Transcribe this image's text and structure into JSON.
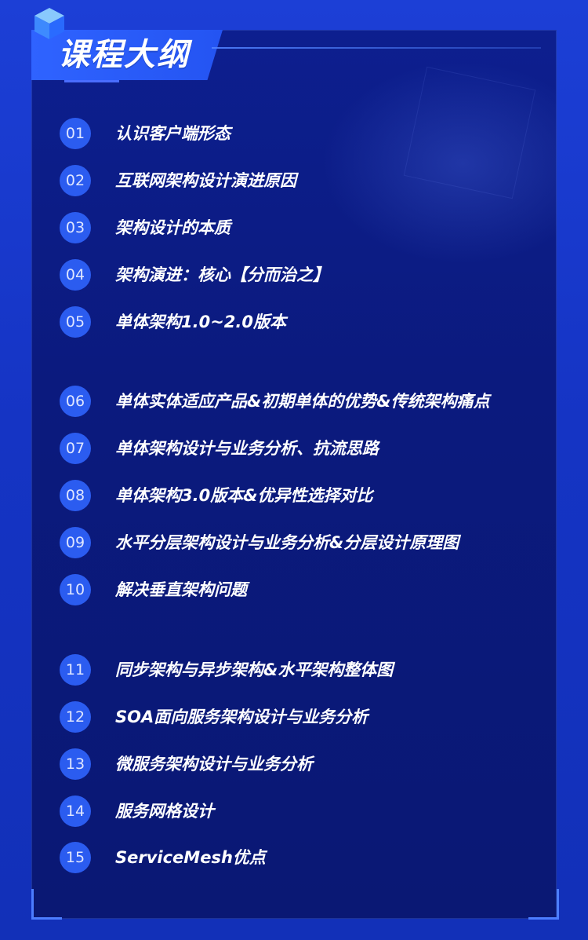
{
  "header": {
    "title": "课程大纲"
  },
  "outline": [
    {
      "num": "01",
      "text": "认识客户端形态"
    },
    {
      "num": "02",
      "text": "互联网架构设计演进原因"
    },
    {
      "num": "03",
      "text": "架构设计的本质"
    },
    {
      "num": "04",
      "text": "架构演进：核心【分而治之】"
    },
    {
      "num": "05",
      "text": "单体架构1.0~2.0版本"
    },
    {
      "num": "06",
      "text": "单体实体适应产品&初期单体的优势&传统架构痛点"
    },
    {
      "num": "07",
      "text": "单体架构设计与业务分析、抗流思路"
    },
    {
      "num": "08",
      "text": "单体架构3.0版本&优异性选择对比"
    },
    {
      "num": "09",
      "text": "水平分层架构设计与业务分析&分层设计原理图"
    },
    {
      "num": "10",
      "text": "解决垂直架构问题"
    },
    {
      "num": "11",
      "text": "同步架构与异步架构&水平架构整体图"
    },
    {
      "num": "12",
      "text": "SOA面向服务架构设计与业务分析"
    },
    {
      "num": "13",
      "text": "微服务架构设计与业务分析"
    },
    {
      "num": "14",
      "text": "服务网格设计"
    },
    {
      "num": "15",
      "text": "ServiceMesh优点"
    }
  ],
  "colors": {
    "background": "#1c3fd6",
    "panel": "#0d1f8f",
    "accent": "#2b5cf0",
    "text": "#ffffff"
  },
  "icons": [
    "cube-icon"
  ]
}
